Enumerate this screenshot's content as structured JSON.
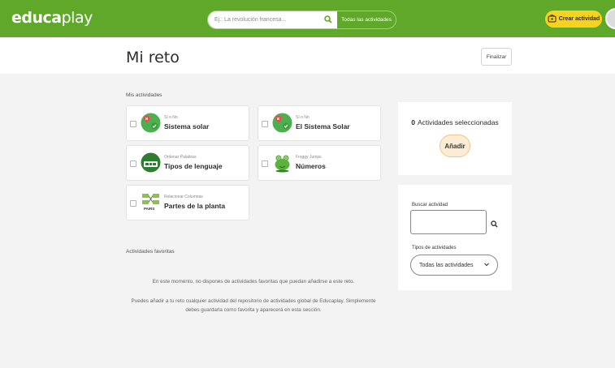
{
  "header": {
    "logo_bold": "educa",
    "logo_thin": "play",
    "search_placeholder": "Ej.: La revolución francesa...",
    "search_scope": "Todas las actividades",
    "create_label": "Crear actividad"
  },
  "page": {
    "title": "Mi reto",
    "finish_label": "Finalizar",
    "my_activities_label": "Mis actividades",
    "favorites_label": "Actividades favoritas",
    "empty_message": "En este momento, no dispones de actividades favoritas que puedan añadirse a este reto.",
    "help_line1": "Puedes añadir a tu reto cualquier actividad del repositorio de actividades global de Educaplay. Simplemente",
    "help_line2": "debes guardarla como favorita y aparecerá en esta sección."
  },
  "activities": [
    {
      "type": "Sí o No",
      "name": "Sistema solar",
      "icon": "yes-no-icon"
    },
    {
      "type": "Sí o No",
      "name": "El Sistema Solar",
      "icon": "yes-no-icon"
    },
    {
      "type": "Ordenar Palabras",
      "name": "Tipos de lenguaje",
      "icon": "order-words-icon"
    },
    {
      "type": "Froggy Jumps",
      "name": "Números",
      "icon": "froggy-icon"
    },
    {
      "type": "Relacionar Columnas",
      "name": "Partes de la planta",
      "icon": "match-columns-icon",
      "thumb_text": "PAIRS"
    }
  ],
  "selection": {
    "count": "0",
    "label": "Actividades seleccionadas",
    "add_label": "Añadir"
  },
  "filter": {
    "search_label": "Buscar actividad",
    "types_label": "Tipos de actividades",
    "types_value": "Todas las actividades"
  },
  "colors": {
    "brand_green": "#5fa82a",
    "accent_yellow": "#f7d21e"
  }
}
